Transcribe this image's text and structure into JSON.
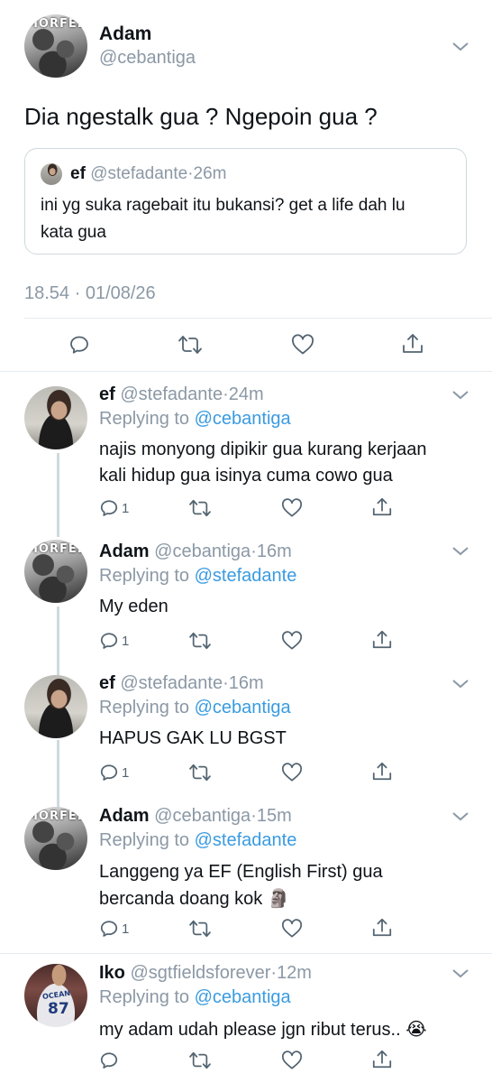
{
  "main_tweet": {
    "name": "Adam",
    "handle": "@cebantiga",
    "text": "Dia ngestalk gua ? Ngepoin gua ?",
    "avatar_text": "MORFEE",
    "quote": {
      "name": "ef",
      "handle": "@stefadante",
      "time": "26m",
      "text_line1": "ini yg suka ragebait itu bukansi? get a life dah lu",
      "text_line2": "kata gua"
    },
    "timestamp": "18.54 · 01/08/26"
  },
  "replies": [
    {
      "name": "ef",
      "handle": "@stefadante",
      "time": "24m",
      "replying_label": "Replying to",
      "replying_to": "@cebantiga",
      "line1": "najis monyong dipikir gua kurang kerjaan",
      "line2": "kali hidup gua isinya cuma cowo gua",
      "reply_count": "1"
    },
    {
      "name": "Adam",
      "handle": "@cebantiga",
      "time": "16m",
      "replying_label": "Replying to",
      "replying_to": "@stefadante",
      "line1": "My eden",
      "line2": "",
      "reply_count": "1",
      "avatar_text": "MORFEE"
    },
    {
      "name": "ef",
      "handle": "@stefadante",
      "time": "16m",
      "replying_label": "Replying to",
      "replying_to": "@cebantiga",
      "line1": "HAPUS GAK LU BGST",
      "line2": "",
      "reply_count": "1"
    },
    {
      "name": "Adam",
      "handle": "@cebantiga",
      "time": "15m",
      "replying_label": "Replying to",
      "replying_to": "@stefadante",
      "line1": "Langgeng ya EF (English First) gua",
      "line2": "bercanda doang kok",
      "line2_emoji": "🗿",
      "reply_count": "1",
      "avatar_text": "MORFEE"
    },
    {
      "name": "Iko",
      "handle": "@sgtfieldsforever",
      "time": "12m",
      "replying_label": "Replying to",
      "replying_to": "@cebantiga",
      "line1": "my adam udah please jgn ribut terus..",
      "line1_emoji": "😭",
      "avatar_number": "87",
      "avatar_word": "OCEAN"
    }
  ],
  "separator": "·",
  "icons": [
    "reply-icon",
    "retweet-icon",
    "like-icon",
    "share-icon",
    "chevron-down-icon"
  ],
  "colors": {
    "link": "#3a9be0",
    "muted": "#8b98a5",
    "text": "#0f1419",
    "divider": "#e6ecf0"
  }
}
